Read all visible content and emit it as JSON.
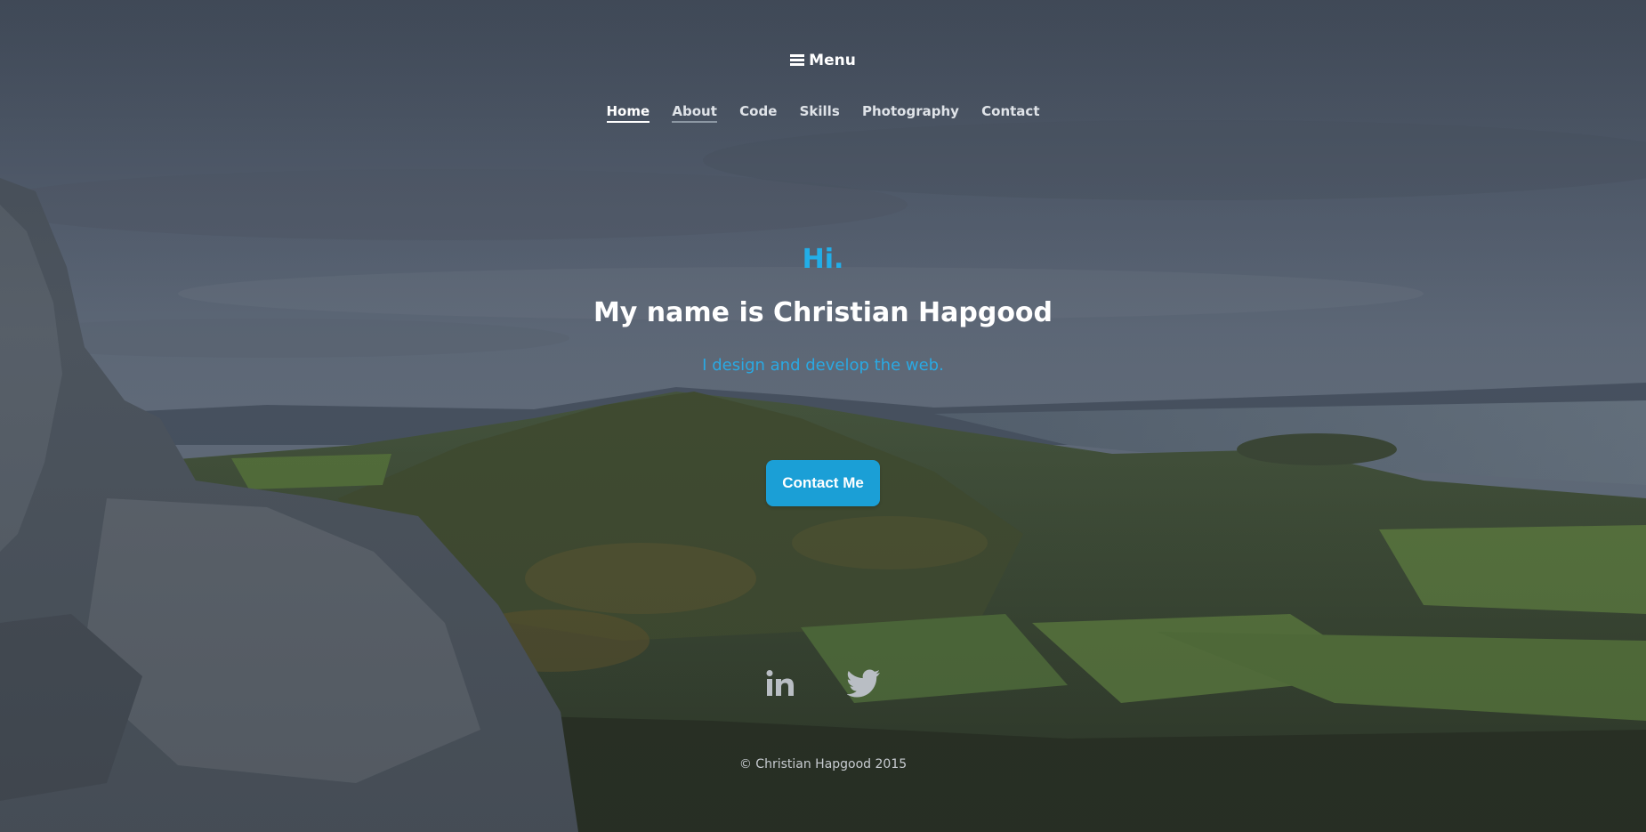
{
  "menu": {
    "toggle_label": "Menu",
    "icon": "hamburger-icon"
  },
  "nav": {
    "items": [
      {
        "label": "Home",
        "state": "active"
      },
      {
        "label": "About",
        "state": "hover"
      },
      {
        "label": "Code",
        "state": "default"
      },
      {
        "label": "Skills",
        "state": "default"
      },
      {
        "label": "Photography",
        "state": "default"
      },
      {
        "label": "Contact",
        "state": "default"
      }
    ]
  },
  "hero": {
    "greeting": "Hi.",
    "headline": "My name is Christian Hapgood",
    "tagline": "I design and develop the web.",
    "cta_label": "Contact Me"
  },
  "social": {
    "links": [
      {
        "icon": "linkedin-icon"
      },
      {
        "icon": "twitter-icon"
      }
    ]
  },
  "footer": {
    "copyright": "© Christian Hapgood 2015"
  },
  "colors": {
    "accent": "#1b9fd6",
    "greeting": "#22aee8",
    "text": "#ffffff"
  }
}
